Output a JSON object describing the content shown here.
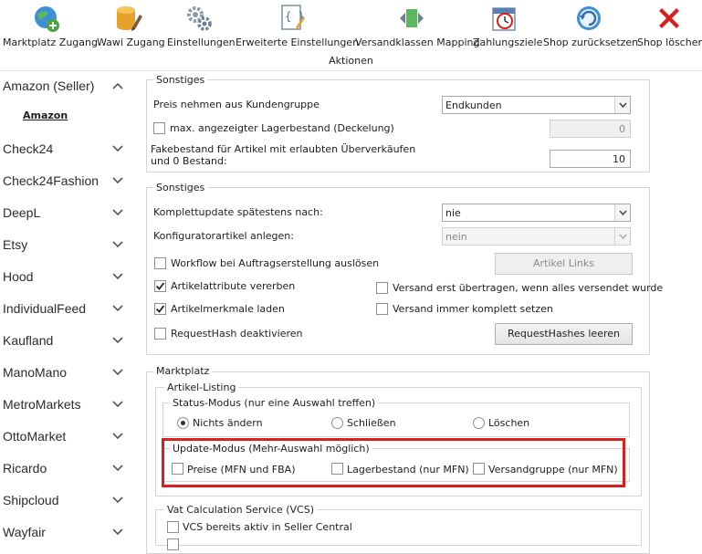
{
  "toolbar": {
    "buttons": [
      {
        "label": "Marktplatz Zugang",
        "icon": "globe-plus-icon"
      },
      {
        "label": "Wawi Zugang",
        "icon": "database-pencil-icon"
      },
      {
        "label": "Einstellungen",
        "icon": "gears-icon"
      },
      {
        "label": "Erweiterte Einstellungen",
        "icon": "code-document-icon"
      },
      {
        "label": "Versandklassen Mapping",
        "icon": "mapping-arrows-icon"
      },
      {
        "label": "Zahlungsziele",
        "icon": "calendar-clock-icon"
      },
      {
        "label": "Shop zurücksetzen",
        "icon": "reset-arrow-icon"
      },
      {
        "label": "Shop löschen",
        "icon": "delete-x-icon"
      }
    ],
    "group_caption": "Aktionen"
  },
  "sidebar": {
    "items": [
      {
        "label": "Amazon (Seller)",
        "expanded": true
      },
      {
        "label": "Check24"
      },
      {
        "label": "Check24Fashion"
      },
      {
        "label": "DeepL"
      },
      {
        "label": "Etsy"
      },
      {
        "label": "Hood"
      },
      {
        "label": "IndividualFeed"
      },
      {
        "label": "Kaufland"
      },
      {
        "label": "ManoMano"
      },
      {
        "label": "MetroMarkets"
      },
      {
        "label": "OttoMarket"
      },
      {
        "label": "Ricardo"
      },
      {
        "label": "Shipcloud"
      },
      {
        "label": "Wayfair"
      }
    ],
    "sub_item": "Amazon"
  },
  "group1": {
    "title": "Sonstiges",
    "price_group_label": "Preis nehmen aus Kundengruppe",
    "price_group_value": "Endkunden",
    "max_stock_label": "max. angezeigter Lagerbestand (Deckelung)",
    "max_stock_value": "0",
    "fake_stock_label_1": "Fakebestand für Artikel mit erlaubten Überverkäufen",
    "fake_stock_label_2": "und 0 Bestand:",
    "fake_stock_value": "10"
  },
  "group2": {
    "title": "Sonstiges",
    "full_update_label": "Komplettupdate spätestens nach:",
    "full_update_value": "nie",
    "configurator_label": "Konfiguratorartikel anlegen:",
    "configurator_value": "nein",
    "workflow_label": "Workflow bei Auftragserstellung auslösen",
    "artikel_links_button": "Artikel Links",
    "inherit_attrs_label": "Artikelattribute vererben",
    "ship_after_all_label": "Versand erst übertragen, wenn alles versendet wurde",
    "load_features_label": "Artikelmerkmale laden",
    "ship_complete_label": "Versand immer komplett setzen",
    "request_hash_label": "RequestHash deaktivieren",
    "clear_hashes_button": "RequestHashes leeren"
  },
  "marketplace": {
    "title": "Marktplatz",
    "listing_title": "Artikel-Listing",
    "status_title": "Status-Modus (nur eine Auswahl treffen)",
    "status_options": [
      "Nichts ändern",
      "Schließen",
      "Löschen"
    ],
    "update_title": "Update-Modus (Mehr-Auswahl möglich)",
    "update_options": [
      "Preise (MFN und FBA)",
      "Lagerbestand (nur MFN)",
      "Versandgruppe (nur MFN)"
    ],
    "vcs_title": "Vat Calculation Service (VCS)",
    "vcs_option": "VCS bereits aktiv in Seller Central"
  },
  "colors": {
    "highlight": "#d9201c",
    "border": "#d5d5d5"
  }
}
